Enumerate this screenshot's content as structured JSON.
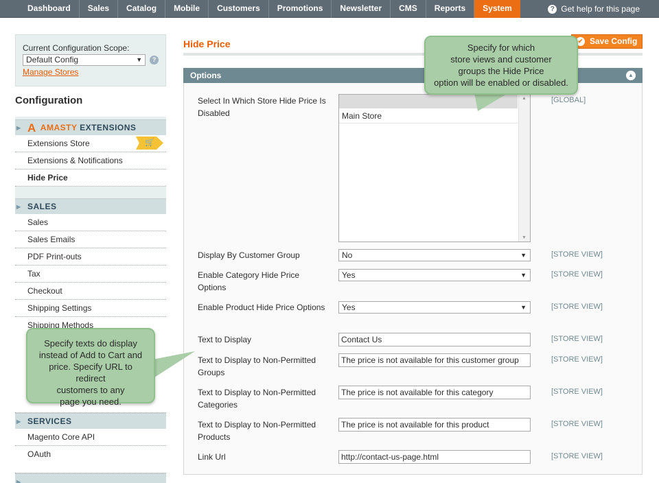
{
  "nav": {
    "items": [
      "Dashboard",
      "Sales",
      "Catalog",
      "Mobile",
      "Customers",
      "Promotions",
      "Newsletter",
      "CMS",
      "Reports",
      "System"
    ],
    "active": "System",
    "help": "Get help for this page"
  },
  "scope": {
    "label": "Current Configuration Scope:",
    "selected": "Default Config",
    "manage_link": "Manage Stores"
  },
  "sidebar": {
    "heading": "Configuration",
    "amasty": {
      "brand": "AMASTY",
      "suffix": "EXTENSIONS"
    },
    "amasty_items": [
      "Extensions Store",
      "Extensions & Notifications",
      "Hide Price"
    ],
    "selected_item": "Hide Price",
    "sales": {
      "title": "SALES",
      "items": [
        "Sales",
        "Sales Emails",
        "PDF Print-outs",
        "Tax",
        "Checkout",
        "Shipping Settings",
        "Shipping Methods"
      ]
    },
    "services": {
      "title": "SERVICES",
      "items": [
        "Magento Core API",
        "OAuth"
      ]
    }
  },
  "main": {
    "title": "Hide Price",
    "save_label": "Save Config",
    "section_title": "Options",
    "fields": {
      "store_label": "Select In Which Store Hide Price Is Disabled",
      "store_options": [
        "Main Store"
      ],
      "store_scope": "[GLOBAL]",
      "group_label": "Display By Customer Group",
      "group_value": "No",
      "group_scope": "[STORE VIEW]",
      "category_label": "Enable Category Hide Price Options",
      "category_value": "Yes",
      "category_scope": "[STORE VIEW]",
      "product_label": "Enable Product Hide Price Options",
      "product_value": "Yes",
      "product_scope": "[STORE VIEW]",
      "text_label": "Text to Display",
      "text_value": "Contact Us",
      "text_scope": "[STORE VIEW]",
      "np_groups_label": "Text to Display to Non-Permitted Groups",
      "np_groups_value": "The price is not available for this customer group",
      "np_groups_scope": "[STORE VIEW]",
      "np_categories_label": "Text to Display to Non-Permitted Categories",
      "np_categories_value": "The price is not available for this category",
      "np_categories_scope": "[STORE VIEW]",
      "np_products_label": "Text to Display to Non-Permitted Products",
      "np_products_value": "The price is not available for this product",
      "np_products_scope": "[STORE VIEW]",
      "link_label": "Link Url",
      "link_value": "http://contact-us-page.html",
      "link_scope": "[STORE VIEW]"
    }
  },
  "callouts": {
    "top": [
      "Specify for which",
      "store views and  customer",
      "groups the Hide Price",
      "option will be enabled or disabled."
    ],
    "left": [
      "Specify texts do display",
      "instead of Add to Cart and",
      "price. Specify URL to redirect",
      "customers to any",
      "page you need."
    ]
  },
  "colors": {
    "accent": "#ec6e14",
    "nav_bg": "#5f6b74",
    "section_bar": "#6f8992",
    "callout": "#a9cda6"
  }
}
